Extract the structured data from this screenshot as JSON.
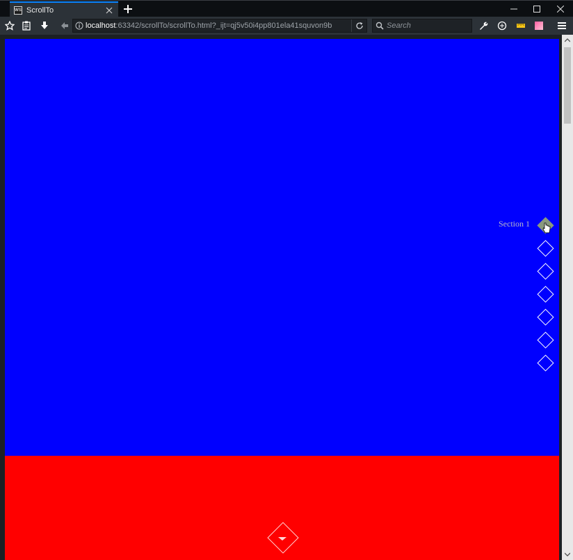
{
  "browser": {
    "tab": {
      "favicon_text": "WS",
      "title": "ScrollTo"
    },
    "url": {
      "host": "localhost",
      "rest": ":63342/scrollTo/scrollTo.html?_ijt=qj5v50i4pp801ela41squvon9b"
    },
    "search": {
      "placeholder": "Search"
    }
  },
  "page": {
    "colors": {
      "section1": "#0000ff",
      "section2": "#ff0000",
      "active_dot": "#8a9a7e"
    },
    "nav": {
      "active_index": 0,
      "items": [
        {
          "label": "Section 1"
        },
        {
          "label": ""
        },
        {
          "label": ""
        },
        {
          "label": ""
        },
        {
          "label": ""
        },
        {
          "label": ""
        },
        {
          "label": ""
        }
      ]
    }
  }
}
